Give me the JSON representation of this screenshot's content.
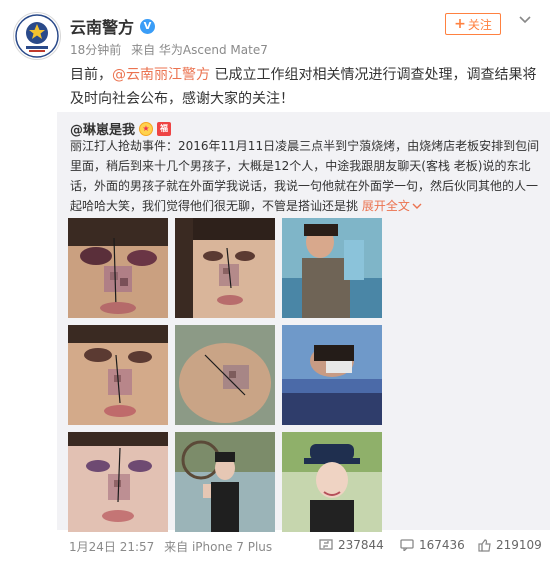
{
  "author": {
    "name": "云南警方",
    "verified_mark": "V",
    "time": "18分钟前",
    "source": "来自 华为Ascend Mate7"
  },
  "follow_button": {
    "plus": "+",
    "label": "关注"
  },
  "post": {
    "prefix": "目前，",
    "mention": "@云南丽江警方",
    "body": " 已成立工作组对相关情况进行调查处理，调查结果将及时向社会公布，感谢大家的关注！"
  },
  "repost": {
    "author": "@琳崽是我",
    "text": "丽江打人抢劫事件：2016年11月11日凌晨三点半到宁蒗烧烤，由烧烤店老板安排到包间里面，稍后到来十几个男孩子，大概是12个人，中途我跟朋友聊天(客栈 老板)说的东北话，外面的男孩子就在外面学我说话，我说一句他就在外面学一句，然后伙同其他的人一起哈哈大笑，我们觉得他们很无聊，不管是搭讪还是挑 ",
    "expand": "展开全文",
    "expand_icon": "chevron-down-icon",
    "photos": [
      {
        "caption": ""
      },
      {
        "caption": ""
      },
      {
        "caption": ""
      },
      {
        "caption": ""
      },
      {
        "caption": ""
      },
      {
        "caption": ""
      },
      {
        "caption": ""
      },
      {
        "caption": ""
      },
      {
        "caption": ""
      }
    ]
  },
  "footer": {
    "time": "1月24日 21:57",
    "source": "来自 iPhone 7 Plus",
    "reposts": "237844",
    "comments": "167436",
    "likes": "219109"
  },
  "colors": {
    "accent": "#eb7350",
    "follow": "#ff8140",
    "verified": "#3a9df7",
    "repost_bg": "#f2f2f5"
  }
}
